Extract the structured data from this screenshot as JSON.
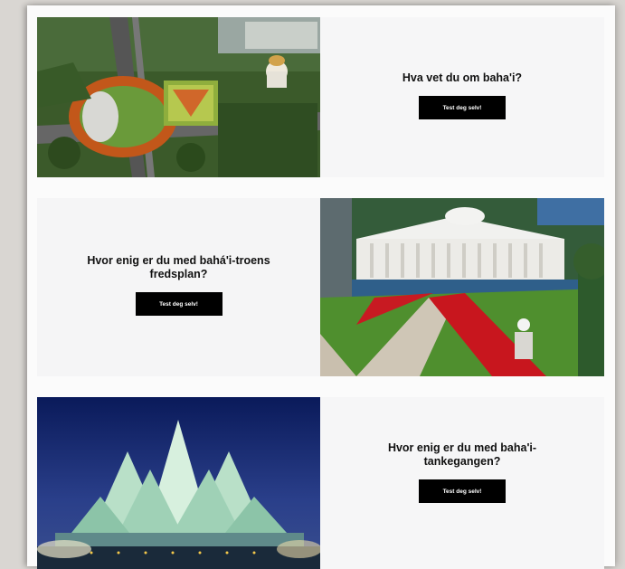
{
  "sections": [
    {
      "heading": "Hva vet du om baha'i?",
      "button_label": "Test deg selv!",
      "image": "terraced-gardens-aerial-photo"
    },
    {
      "heading": "Hvor enig er du med bahá'i-troens fredsplan?",
      "button_label": "Test deg selv!",
      "image": "white-colonnaded-building-with-red-flowers-photo"
    },
    {
      "heading": "Hvor enig er du med baha'i-tankegangen?",
      "button_label": "Test deg selv!",
      "image": "lotus-temple-at-night-photo"
    }
  ]
}
